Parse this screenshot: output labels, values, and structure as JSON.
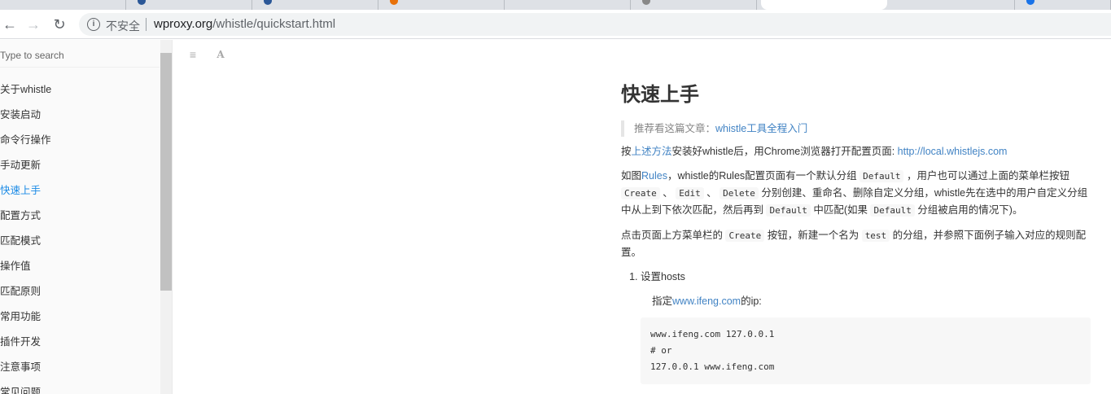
{
  "browser": {
    "security_label": "不安全",
    "url_host": "wproxy.org",
    "url_path": "/whistle/quickstart.html"
  },
  "sidebar": {
    "search_placeholder": "Type to search",
    "items": [
      {
        "label": "关于whistle"
      },
      {
        "label": "安装启动"
      },
      {
        "label": "命令行操作"
      },
      {
        "label": "手动更新"
      },
      {
        "label": "快速上手",
        "active": true
      },
      {
        "label": "配置方式"
      },
      {
        "label": "匹配模式"
      },
      {
        "label": "操作值"
      },
      {
        "label": "匹配原则"
      },
      {
        "label": "常用功能"
      },
      {
        "label": "插件开发"
      },
      {
        "label": "注意事项"
      },
      {
        "label": "常见问题"
      }
    ]
  },
  "content": {
    "title": "快速上手",
    "quote_prefix": "推荐看这篇文章：",
    "quote_link": "whistle工具全程入门",
    "p1_a": "按",
    "p1_link1": "上述方法",
    "p1_b": "安装好whistle后，用Chrome浏览器打开配置页面: ",
    "p1_link2": "http://local.whistlejs.com",
    "p2_a": "如图",
    "p2_link": "Rules",
    "p2_b": "，whistle的Rules配置页面有一个默认分组 ",
    "code_default": "Default",
    "p2_c": " ，用户也可以通过上面的菜单栏按钮 ",
    "code_create": "Create",
    "p2_sep1": " 、 ",
    "code_edit": "Edit",
    "p2_sep2": " 、 ",
    "code_delete": "Delete",
    "p2_d": " 分别创建、重命名、删除自定义分组，whistle先在选中的用户自定义分组中从上到下依次匹配，然后再到 ",
    "p2_e": " 中匹配(如果 ",
    "p2_f": " 分组被启用的情况下)。",
    "p3_a": "点击页面上方菜单栏的 ",
    "p3_b": " 按钮，新建一个名为 ",
    "code_test": "test",
    "p3_c": " 的分组，并参照下面例子输入对应的规则配置。",
    "step1_title": "设置hosts",
    "step1_sub_a": "指定",
    "step1_sub_link": "www.ifeng.com",
    "step1_sub_b": "的ip:",
    "code_line1": "www.ifeng.com 127.0.0.1",
    "code_line2": "# or",
    "code_line3": "127.0.0.1 www.ifeng.com"
  }
}
